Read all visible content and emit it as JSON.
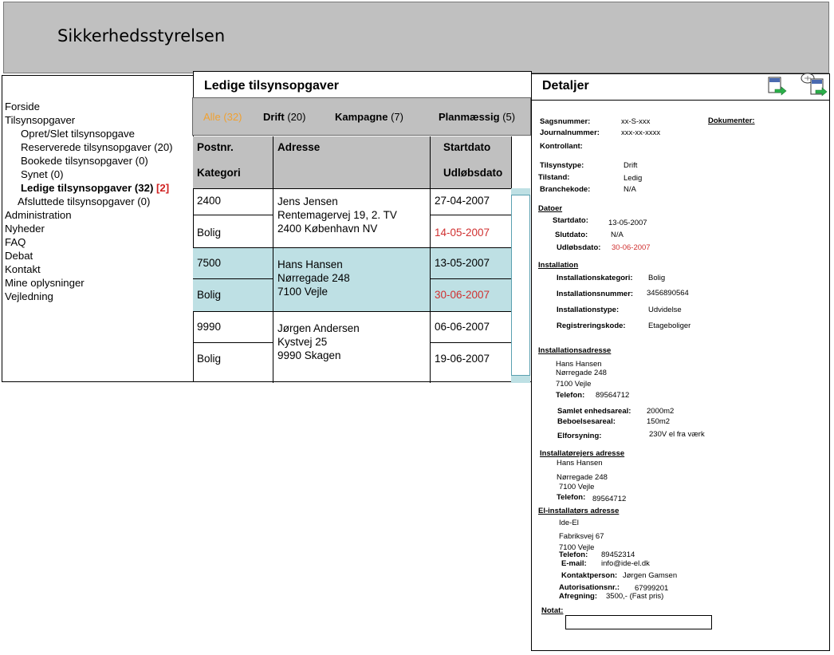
{
  "header": {
    "title": "Sikkerhedsstyrelsen"
  },
  "sidebar": {
    "items": [
      {
        "label": "Forside"
      },
      {
        "label": "Tilsynsopgaver"
      },
      {
        "label": "Opret/Slet tilsynsopgave"
      },
      {
        "label": "Reserverede tilsynsopgaver (20)"
      },
      {
        "label": "Bookede tilsynsopgaver (0)"
      },
      {
        "label": "Synet (0)"
      },
      {
        "label": "Ledige tilsynsopgaver (32)",
        "badge": "[2]"
      },
      {
        "label": "Afsluttede tilsynsopgaver (0)"
      },
      {
        "label": "Administration"
      },
      {
        "label": "Nyheder"
      },
      {
        "label": "FAQ"
      },
      {
        "label": "Debat"
      },
      {
        "label": "Kontakt"
      },
      {
        "label": "Mine oplysninger"
      },
      {
        "label": "Vejledning"
      }
    ]
  },
  "list": {
    "title": "Ledige tilsynsopgaver",
    "filters": [
      {
        "name": "Alle",
        "count": "(32)"
      },
      {
        "name": "Drift",
        "count": "(20)"
      },
      {
        "name": "Kampagne",
        "count": "(7)"
      },
      {
        "name": "Planmæssig",
        "count": "(5)"
      }
    ],
    "headers": {
      "postnr": "Postnr.",
      "kategori": "Kategori",
      "adresse": "Adresse",
      "startdato": "Startdato",
      "udlobsdato": "Udløbsdato"
    },
    "rows": [
      {
        "postnr": "2400",
        "kategori": "Bolig",
        "adresse": [
          "Jens Jensen",
          "Rentemagervej 19, 2. TV",
          "2400 København NV"
        ],
        "start": "27-04-2007",
        "udlob": "14-05-2007"
      },
      {
        "postnr": "7500",
        "kategori": "Bolig",
        "adresse": [
          "Hans Hansen",
          "Nørregade 248",
          "7100 Vejle"
        ],
        "start": "13-05-2007",
        "udlob": "30-06-2007"
      },
      {
        "postnr": "9990",
        "kategori": "Bolig",
        "adresse": [
          "Jørgen Andersen",
          "Kystvej 25",
          "9990 Skagen"
        ],
        "start": "06-06-2007",
        "udlob": "19-06-2007"
      }
    ],
    "expired_color": "#d03030",
    "highlight_color": "#bee0e4",
    "active_filter_color": "#f0a030"
  },
  "detail": {
    "title": "Detaljer",
    "sagsnummer_label": "Sagsnummer:",
    "sagsnummer": "xx-S-xxx",
    "journalnummer_label": "Journalnummer:",
    "journalnummer": "xxx-xx-xxxx",
    "kontrollant_label": "Kontrollant:",
    "dokumenter_label": "Dokumenter:",
    "tilsynstype_label": "Tilsynstype:",
    "tilsynstype": "Drift",
    "tilstand_label": "Tilstand:",
    "tilstand": "Ledig",
    "branchekode_label": "Branchekode:",
    "branchekode": "N/A",
    "datoer": {
      "heading": "Datoer",
      "startdato_label": "Startdato:",
      "startdato": "13-05-2007",
      "slutdato_label": "Slutdato:",
      "slutdato": "N/A",
      "udlobsdato_label": "Udløbsdato:",
      "udlobsdato": "30-06-2007"
    },
    "installation": {
      "heading": "Installation",
      "kategori_label": "Installationskategori:",
      "kategori": "Bolig",
      "nummer_label": "Installationsnummer:",
      "nummer": "3456890564",
      "type_label": "Installationstype:",
      "type": "Udvidelse",
      "reg_label": "Registreringskode:",
      "reg": "Etageboliger"
    },
    "installationsadresse": {
      "heading": "Installationsadresse",
      "name": "Hans Hansen",
      "street": "Nørregade 248",
      "city": "7100 Vejle",
      "telefon_label": "Telefon:",
      "telefon": "89564712",
      "samlet_label": "Samlet enhedsareal:",
      "samlet": "2000m2",
      "bebo_label": "Beboelsesareal:",
      "bebo": "150m2",
      "elf_label": "Elforsyning:",
      "elf": "230V el fra værk"
    },
    "installatorejers": {
      "heading": "Installatørejers adresse",
      "name": "Hans Hansen",
      "street": "Nørregade 248",
      "city": "7100 Vejle",
      "telefon_label": "Telefon:",
      "telefon": "89564712"
    },
    "elinstallator": {
      "heading": "El-installatørs adresse",
      "name": "Ide-El",
      "street": "Fabriksvej 67",
      "city": "7100 Vejle",
      "telefon_label": "Telefon:",
      "telefon": "89452314",
      "email_label": "E-mail:",
      "email": "info@ide-el.dk",
      "kontakt_label": "Kontaktperson:",
      "kontakt": "Jørgen Gamsen",
      "aut_label": "Autorisationsnr.:",
      "aut": "67999201",
      "afregning_label": "Afregning:",
      "afregning": "3500,- (Fast pris)"
    },
    "notat_label": "Notat:"
  }
}
